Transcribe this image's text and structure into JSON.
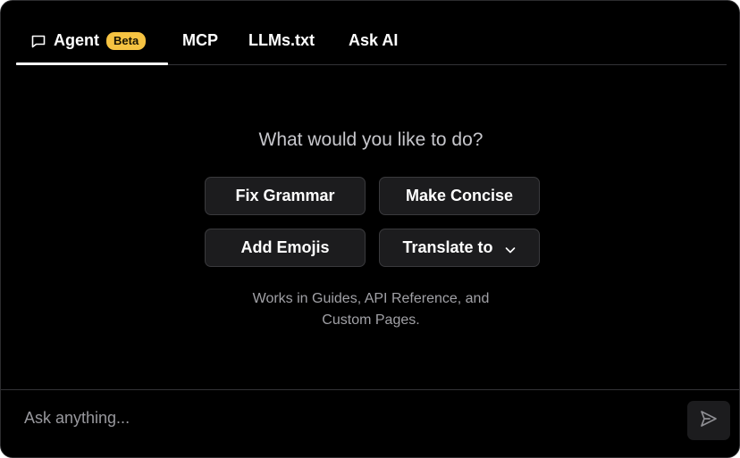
{
  "tabs": {
    "agent": {
      "label": "Agent",
      "badge": "Beta",
      "icon": "chat-icon"
    },
    "mcp": {
      "label": "MCP"
    },
    "llms": {
      "label": "LLMs.txt"
    },
    "ask_ai": {
      "label": "Ask AI"
    },
    "active": "Agent"
  },
  "main": {
    "title": "What would you like to do?",
    "actions": {
      "fix_grammar": "Fix Grammar",
      "make_concise": "Make Concise",
      "add_emojis": "Add Emojis",
      "translate_to": "Translate to"
    },
    "note_line1": "Works in Guides, API Reference, and",
    "note_line2": "Custom Pages."
  },
  "input": {
    "placeholder": "Ask anything...",
    "value": "",
    "send_icon": "send-icon"
  },
  "colors": {
    "background": "#000000",
    "badge": "#f6c342",
    "button_bg": "#1c1c1e",
    "button_border": "#3a3a3d"
  }
}
